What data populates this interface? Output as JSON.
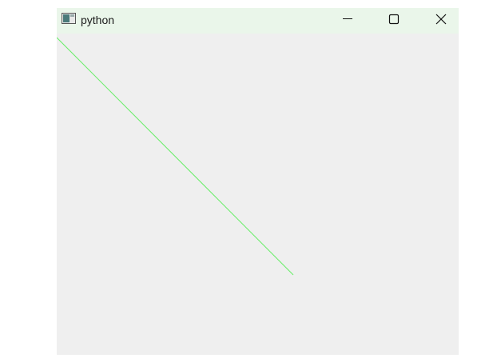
{
  "window": {
    "title": "python",
    "background_color": "#efefef",
    "titlebar_color": "#eaf6ea"
  },
  "controls": {
    "minimize_icon": "minimize-icon",
    "maximize_icon": "maximize-icon",
    "close_icon": "close-icon"
  },
  "canvas": {
    "line_color": "#66ee66"
  }
}
